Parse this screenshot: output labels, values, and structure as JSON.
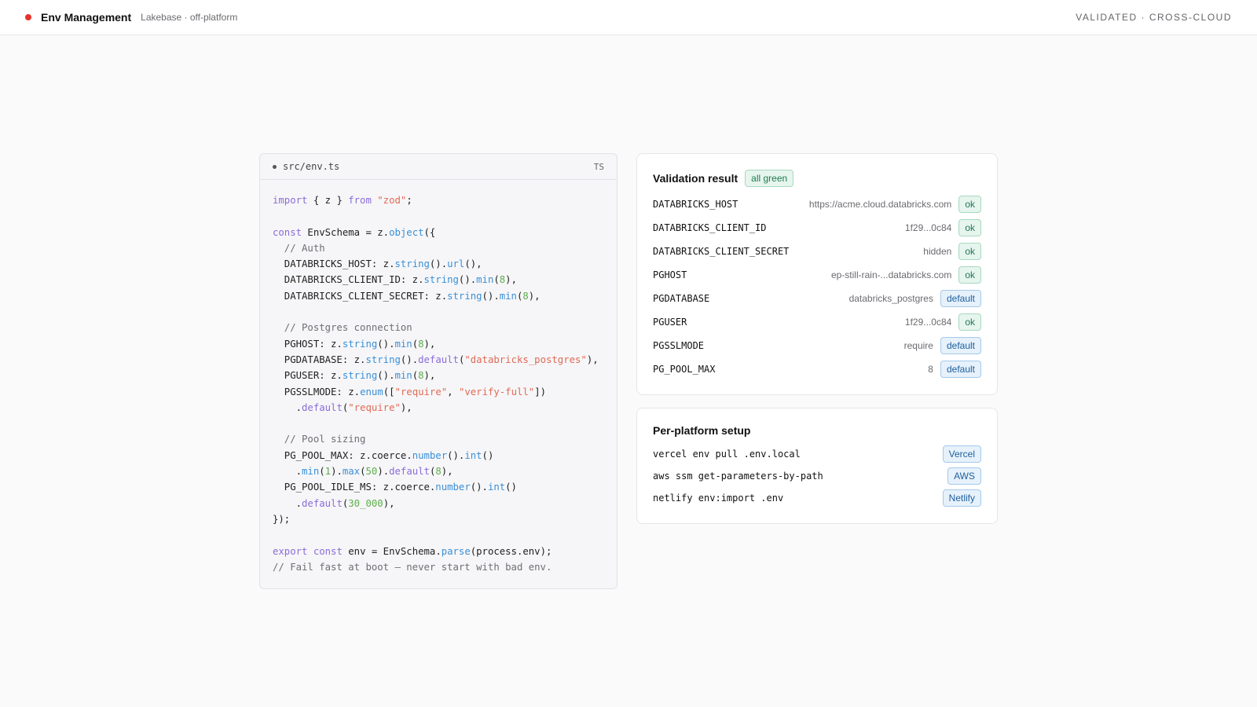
{
  "header": {
    "title": "Env Management",
    "subtitle": "Lakebase · off-platform",
    "status_right": "VALIDATED · CROSS-CLOUD",
    "status_dot_color": "#e5322e"
  },
  "editor": {
    "filename": "src/env.ts",
    "language": "TS",
    "lines": [
      [
        [
          "kw",
          "import"
        ],
        [
          "p",
          " { z } "
        ],
        [
          "kw",
          "from"
        ],
        [
          "p",
          " "
        ],
        [
          "str",
          "\"zod\""
        ],
        [
          "p",
          ";"
        ]
      ],
      [],
      [
        [
          "kw",
          "const"
        ],
        [
          "p",
          " EnvSchema = z."
        ],
        [
          "fn",
          "object"
        ],
        [
          "p",
          "({"
        ]
      ],
      [
        [
          "cm",
          "  // Auth"
        ]
      ],
      [
        [
          "p",
          "  DATABRICKS_HOST: z."
        ],
        [
          "fn",
          "string"
        ],
        [
          "p",
          "()."
        ],
        [
          "fn",
          "url"
        ],
        [
          "p",
          "(),"
        ]
      ],
      [
        [
          "p",
          "  DATABRICKS_CLIENT_ID: z."
        ],
        [
          "fn",
          "string"
        ],
        [
          "p",
          "()."
        ],
        [
          "fn",
          "min"
        ],
        [
          "p",
          "("
        ],
        [
          "num",
          "8"
        ],
        [
          "p",
          "),"
        ]
      ],
      [
        [
          "p",
          "  DATABRICKS_CLIENT_SECRET: z."
        ],
        [
          "fn",
          "string"
        ],
        [
          "p",
          "()."
        ],
        [
          "fn",
          "min"
        ],
        [
          "p",
          "("
        ],
        [
          "num",
          "8"
        ],
        [
          "p",
          "),"
        ]
      ],
      [],
      [
        [
          "cm",
          "  // Postgres connection"
        ]
      ],
      [
        [
          "p",
          "  PGHOST: z."
        ],
        [
          "fn",
          "string"
        ],
        [
          "p",
          "()."
        ],
        [
          "fn",
          "min"
        ],
        [
          "p",
          "("
        ],
        [
          "num",
          "8"
        ],
        [
          "p",
          "),"
        ]
      ],
      [
        [
          "p",
          "  PGDATABASE: z."
        ],
        [
          "fn",
          "string"
        ],
        [
          "p",
          "()."
        ],
        [
          "kw",
          "default"
        ],
        [
          "p",
          "("
        ],
        [
          "str",
          "\"databricks_postgres\""
        ],
        [
          "p",
          "),"
        ]
      ],
      [
        [
          "p",
          "  PGUSER: z."
        ],
        [
          "fn",
          "string"
        ],
        [
          "p",
          "()."
        ],
        [
          "fn",
          "min"
        ],
        [
          "p",
          "("
        ],
        [
          "num",
          "8"
        ],
        [
          "p",
          "),"
        ]
      ],
      [
        [
          "p",
          "  PGSSLMODE: z."
        ],
        [
          "fn",
          "enum"
        ],
        [
          "p",
          "(["
        ],
        [
          "str",
          "\"require\""
        ],
        [
          "p",
          ", "
        ],
        [
          "str",
          "\"verify-full\""
        ],
        [
          "p",
          "])"
        ]
      ],
      [
        [
          "p",
          "    ."
        ],
        [
          "kw",
          "default"
        ],
        [
          "p",
          "("
        ],
        [
          "str",
          "\"require\""
        ],
        [
          "p",
          "),"
        ]
      ],
      [],
      [
        [
          "cm",
          "  // Pool sizing"
        ]
      ],
      [
        [
          "p",
          "  PG_POOL_MAX: z.coerce."
        ],
        [
          "fn",
          "number"
        ],
        [
          "p",
          "()."
        ],
        [
          "fn",
          "int"
        ],
        [
          "p",
          "()"
        ]
      ],
      [
        [
          "p",
          "    ."
        ],
        [
          "fn",
          "min"
        ],
        [
          "p",
          "("
        ],
        [
          "num",
          "1"
        ],
        [
          "p",
          ")."
        ],
        [
          "fn",
          "max"
        ],
        [
          "p",
          "("
        ],
        [
          "num",
          "50"
        ],
        [
          "p",
          ")."
        ],
        [
          "kw",
          "default"
        ],
        [
          "p",
          "("
        ],
        [
          "num",
          "8"
        ],
        [
          "p",
          "),"
        ]
      ],
      [
        [
          "p",
          "  PG_POOL_IDLE_MS: z.coerce."
        ],
        [
          "fn",
          "number"
        ],
        [
          "p",
          "()."
        ],
        [
          "fn",
          "int"
        ],
        [
          "p",
          "()"
        ]
      ],
      [
        [
          "p",
          "    ."
        ],
        [
          "kw",
          "default"
        ],
        [
          "p",
          "("
        ],
        [
          "num",
          "30_000"
        ],
        [
          "p",
          "),"
        ]
      ],
      [
        [
          "p",
          "});"
        ]
      ],
      [],
      [
        [
          "kw",
          "export"
        ],
        [
          "p",
          " "
        ],
        [
          "kw",
          "const"
        ],
        [
          "p",
          " env = EnvSchema."
        ],
        [
          "fn",
          "parse"
        ],
        [
          "p",
          "(process.env);"
        ]
      ],
      [
        [
          "cm",
          "// Fail fast at boot — never start with bad env."
        ]
      ]
    ]
  },
  "validation": {
    "title": "Validation result",
    "summary_badge": "all green",
    "rows": [
      {
        "key": "DATABRICKS_HOST",
        "value": "https://acme.cloud.databricks.com",
        "status": "ok"
      },
      {
        "key": "DATABRICKS_CLIENT_ID",
        "value": "1f29...0c84",
        "status": "ok"
      },
      {
        "key": "DATABRICKS_CLIENT_SECRET",
        "value": "hidden",
        "status": "ok"
      },
      {
        "key": "PGHOST",
        "value": "ep-still-rain-...databricks.com",
        "status": "ok"
      },
      {
        "key": "PGDATABASE",
        "value": "databricks_postgres",
        "status": "default"
      },
      {
        "key": "PGUSER",
        "value": "1f29...0c84",
        "status": "ok"
      },
      {
        "key": "PGSSLMODE",
        "value": "require",
        "status": "default"
      },
      {
        "key": "PG_POOL_MAX",
        "value": "8",
        "status": "default"
      }
    ]
  },
  "platforms": {
    "title": "Per-platform setup",
    "rows": [
      {
        "command": "vercel env pull .env.local",
        "platform": "Vercel"
      },
      {
        "command": "aws ssm get-parameters-by-path",
        "platform": "AWS"
      },
      {
        "command": "netlify env:import .env",
        "platform": "Netlify"
      }
    ]
  }
}
